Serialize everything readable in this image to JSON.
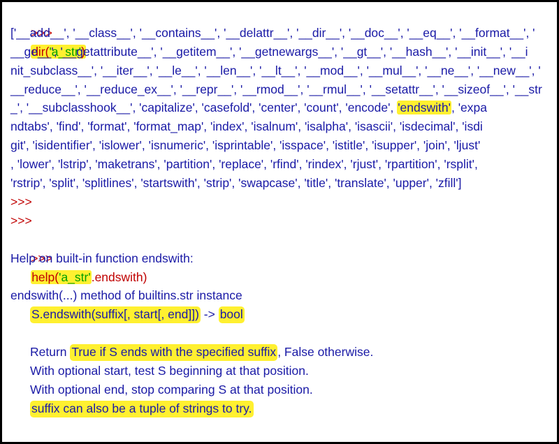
{
  "prompt": ">>>",
  "cmd1": {
    "func": "dir(",
    "arg": "'a_str'",
    "close": ")"
  },
  "dir_output": [
    "['__add__', '__class__', '__contains__', '__delattr__', '__dir__', '__doc__', '__eq__', '__format__', '",
    "__ge__', '__getattribute__', '__getitem__', '__getnewargs__', '__gt__', '__hash__', '__init__', '__i",
    "nit_subclass__', '__iter__', '__le__', '__len__', '__lt__', '__mod__', '__mul__', '__ne__', '__new__', '",
    "__reduce__', '__reduce_ex__', '__repr__', '__rmod__', '__rmul__', '__setattr__', '__sizeof__', '__str",
    "_', '__subclasshook__', 'capitalize', 'casefold', 'center', 'count', 'encode', ",
    "ndtabs', 'find', 'format', 'format_map', 'index', 'isalnum', 'isalpha', 'isascii', 'isdecimal', 'isdi",
    "git', 'isidentifier', 'islower', 'isnumeric', 'isprintable', 'isspace', 'istitle', 'isupper', 'join', 'ljust'",
    ", 'lower', 'lstrip', 'maketrans', 'partition', 'replace', 'rfind', 'rindex', 'rjust', 'rpartition', 'rsplit',",
    "'rstrip', 'split', 'splitlines', 'startswith', 'strip', 'swapcase', 'title', 'translate', 'upper', 'zfill']"
  ],
  "dir_highlight": "'endswith'",
  "dir_highlight_tail": ", 'expa",
  "cmd2": {
    "func": "help(",
    "arg": "'a_str'",
    "rest": ".endswith)"
  },
  "help": {
    "heading": "Help on built-in function endswith:",
    "signature_line": "endswith(...) method of builtins.str instance",
    "usage": "S.endswith(suffix[, start[, end]])",
    "usage_arrow": " -> ",
    "usage_return": "bool",
    "doc_return_pre": "Return ",
    "doc_return_hl": "True if S ends with the specified suffix",
    "doc_return_post": ", False otherwise.",
    "doc_start": "With optional start, test S beginning at that position.",
    "doc_end": "With optional end, stop comparing S at that position.",
    "doc_tuple": "suffix can also be a tuple of strings to try."
  },
  "colors": {
    "prompt": "#c00000",
    "string": "#00a000",
    "output": "#1a1aa6",
    "highlight": "#fff030"
  }
}
